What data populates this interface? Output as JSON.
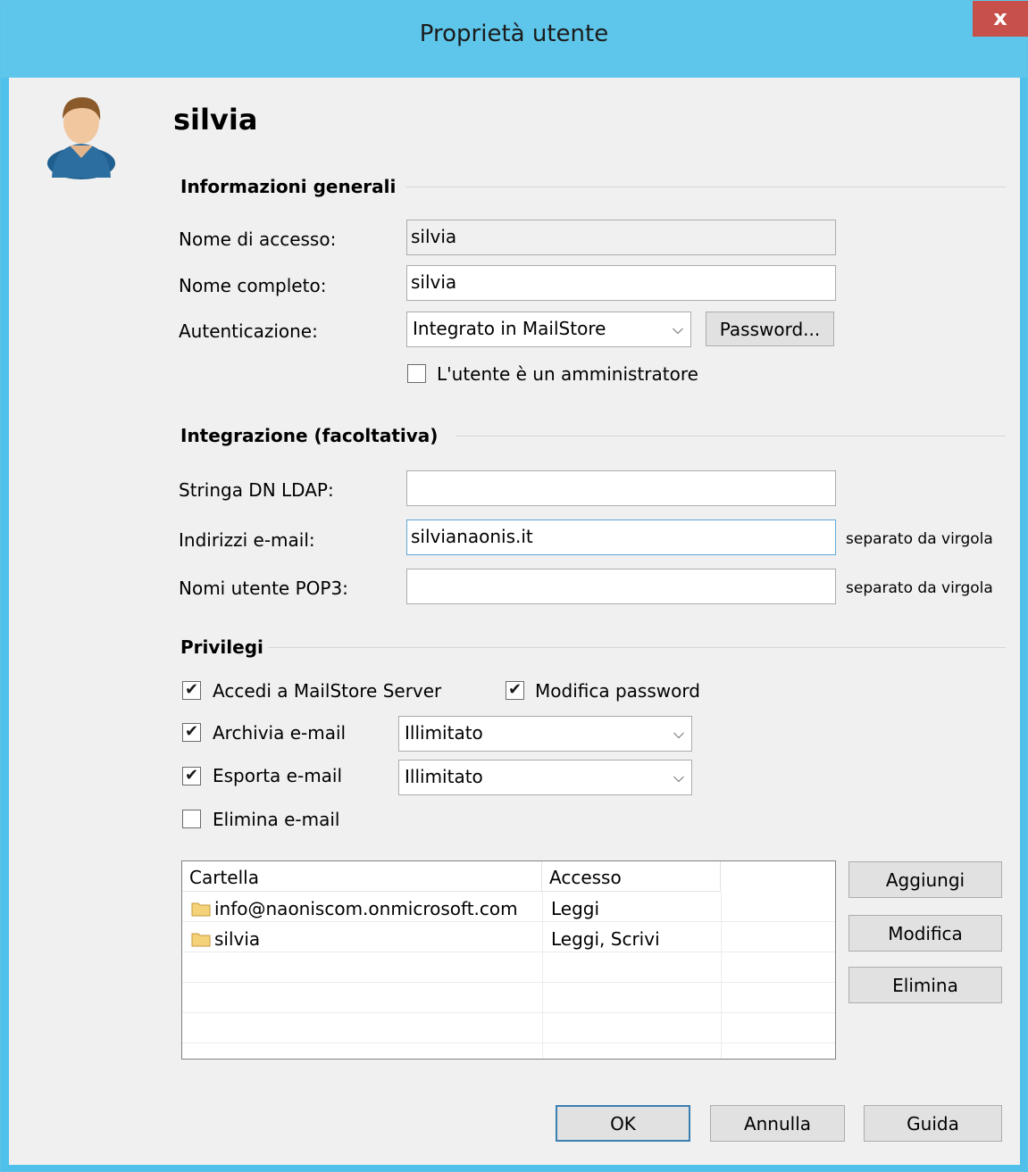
{
  "window": {
    "title": "Proprietà utente",
    "close_glyph": "x"
  },
  "user": {
    "name": "silvia",
    "avatar_icon": "user-avatar-icon"
  },
  "general": {
    "heading": "Informazioni generali",
    "login_label": "Nome di accesso:",
    "login_value": "silvia",
    "fullname_label": "Nome completo:",
    "fullname_value": "silvia",
    "auth_label": "Autenticazione:",
    "auth_value": "Integrato in MailStore",
    "password_button": "Password...",
    "admin_label": "L'utente è un amministratore",
    "admin_checked": false
  },
  "integration": {
    "heading": "Integrazione (facoltativa)",
    "ldap_label": "Stringa DN LDAP:",
    "ldap_value": "",
    "emails_label": "Indirizzi e-mail:",
    "emails_value": "silvianaonis.it",
    "emails_hint": "separato da virgola",
    "pop3_label": "Nomi utente POP3:",
    "pop3_value": "",
    "pop3_hint": "separato da virgola"
  },
  "privileges": {
    "heading": "Privilegi",
    "access_server": {
      "label": "Accedi a MailStore Server",
      "checked": true
    },
    "change_password": {
      "label": "Modifica password",
      "checked": true
    },
    "archive": {
      "label": "Archivia e-mail",
      "checked": true,
      "option": "Illimitato"
    },
    "export": {
      "label": "Esporta e-mail",
      "checked": true,
      "option": "Illimitato"
    },
    "delete": {
      "label": "Elimina e-mail",
      "checked": false
    }
  },
  "folders": {
    "columns": [
      "Cartella",
      "Accesso"
    ],
    "rows": [
      {
        "folder": "info@naoniscom.onmicrosoft.com",
        "access": "Leggi"
      },
      {
        "folder": "silvia",
        "access": "Leggi, Scrivi"
      }
    ],
    "add_button": "Aggiungi",
    "edit_button": "Modifica",
    "delete_button": "Elimina"
  },
  "footer": {
    "ok": "OK",
    "cancel": "Annulla",
    "help": "Guida"
  },
  "colors": {
    "titlebar": "#5ec6ea",
    "close": "#c7504a",
    "dialog_bg": "#f0f0f0"
  }
}
